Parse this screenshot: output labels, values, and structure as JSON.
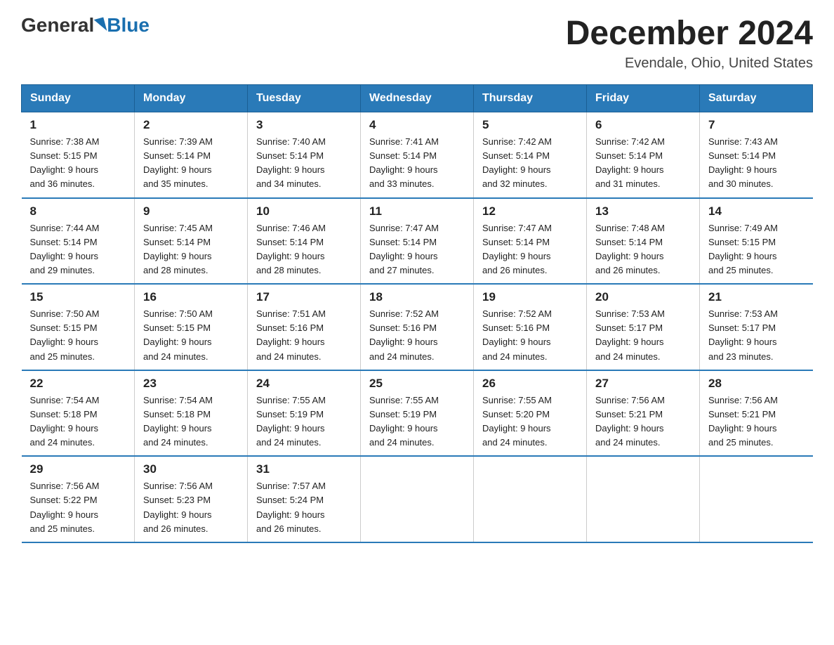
{
  "logo": {
    "general": "General",
    "blue": "Blue"
  },
  "header": {
    "month": "December 2024",
    "location": "Evendale, Ohio, United States"
  },
  "weekdays": [
    "Sunday",
    "Monday",
    "Tuesday",
    "Wednesday",
    "Thursday",
    "Friday",
    "Saturday"
  ],
  "weeks": [
    [
      {
        "day": "1",
        "sunrise": "7:38 AM",
        "sunset": "5:15 PM",
        "daylight": "9 hours and 36 minutes."
      },
      {
        "day": "2",
        "sunrise": "7:39 AM",
        "sunset": "5:14 PM",
        "daylight": "9 hours and 35 minutes."
      },
      {
        "day": "3",
        "sunrise": "7:40 AM",
        "sunset": "5:14 PM",
        "daylight": "9 hours and 34 minutes."
      },
      {
        "day": "4",
        "sunrise": "7:41 AM",
        "sunset": "5:14 PM",
        "daylight": "9 hours and 33 minutes."
      },
      {
        "day": "5",
        "sunrise": "7:42 AM",
        "sunset": "5:14 PM",
        "daylight": "9 hours and 32 minutes."
      },
      {
        "day": "6",
        "sunrise": "7:42 AM",
        "sunset": "5:14 PM",
        "daylight": "9 hours and 31 minutes."
      },
      {
        "day": "7",
        "sunrise": "7:43 AM",
        "sunset": "5:14 PM",
        "daylight": "9 hours and 30 minutes."
      }
    ],
    [
      {
        "day": "8",
        "sunrise": "7:44 AM",
        "sunset": "5:14 PM",
        "daylight": "9 hours and 29 minutes."
      },
      {
        "day": "9",
        "sunrise": "7:45 AM",
        "sunset": "5:14 PM",
        "daylight": "9 hours and 28 minutes."
      },
      {
        "day": "10",
        "sunrise": "7:46 AM",
        "sunset": "5:14 PM",
        "daylight": "9 hours and 28 minutes."
      },
      {
        "day": "11",
        "sunrise": "7:47 AM",
        "sunset": "5:14 PM",
        "daylight": "9 hours and 27 minutes."
      },
      {
        "day": "12",
        "sunrise": "7:47 AM",
        "sunset": "5:14 PM",
        "daylight": "9 hours and 26 minutes."
      },
      {
        "day": "13",
        "sunrise": "7:48 AM",
        "sunset": "5:14 PM",
        "daylight": "9 hours and 26 minutes."
      },
      {
        "day": "14",
        "sunrise": "7:49 AM",
        "sunset": "5:15 PM",
        "daylight": "9 hours and 25 minutes."
      }
    ],
    [
      {
        "day": "15",
        "sunrise": "7:50 AM",
        "sunset": "5:15 PM",
        "daylight": "9 hours and 25 minutes."
      },
      {
        "day": "16",
        "sunrise": "7:50 AM",
        "sunset": "5:15 PM",
        "daylight": "9 hours and 24 minutes."
      },
      {
        "day": "17",
        "sunrise": "7:51 AM",
        "sunset": "5:16 PM",
        "daylight": "9 hours and 24 minutes."
      },
      {
        "day": "18",
        "sunrise": "7:52 AM",
        "sunset": "5:16 PM",
        "daylight": "9 hours and 24 minutes."
      },
      {
        "day": "19",
        "sunrise": "7:52 AM",
        "sunset": "5:16 PM",
        "daylight": "9 hours and 24 minutes."
      },
      {
        "day": "20",
        "sunrise": "7:53 AM",
        "sunset": "5:17 PM",
        "daylight": "9 hours and 24 minutes."
      },
      {
        "day": "21",
        "sunrise": "7:53 AM",
        "sunset": "5:17 PM",
        "daylight": "9 hours and 23 minutes."
      }
    ],
    [
      {
        "day": "22",
        "sunrise": "7:54 AM",
        "sunset": "5:18 PM",
        "daylight": "9 hours and 24 minutes."
      },
      {
        "day": "23",
        "sunrise": "7:54 AM",
        "sunset": "5:18 PM",
        "daylight": "9 hours and 24 minutes."
      },
      {
        "day": "24",
        "sunrise": "7:55 AM",
        "sunset": "5:19 PM",
        "daylight": "9 hours and 24 minutes."
      },
      {
        "day": "25",
        "sunrise": "7:55 AM",
        "sunset": "5:19 PM",
        "daylight": "9 hours and 24 minutes."
      },
      {
        "day": "26",
        "sunrise": "7:55 AM",
        "sunset": "5:20 PM",
        "daylight": "9 hours and 24 minutes."
      },
      {
        "day": "27",
        "sunrise": "7:56 AM",
        "sunset": "5:21 PM",
        "daylight": "9 hours and 24 minutes."
      },
      {
        "day": "28",
        "sunrise": "7:56 AM",
        "sunset": "5:21 PM",
        "daylight": "9 hours and 25 minutes."
      }
    ],
    [
      {
        "day": "29",
        "sunrise": "7:56 AM",
        "sunset": "5:22 PM",
        "daylight": "9 hours and 25 minutes."
      },
      {
        "day": "30",
        "sunrise": "7:56 AM",
        "sunset": "5:23 PM",
        "daylight": "9 hours and 26 minutes."
      },
      {
        "day": "31",
        "sunrise": "7:57 AM",
        "sunset": "5:24 PM",
        "daylight": "9 hours and 26 minutes."
      },
      null,
      null,
      null,
      null
    ]
  ],
  "labels": {
    "sunrise": "Sunrise: ",
    "sunset": "Sunset: ",
    "daylight": "Daylight: "
  }
}
